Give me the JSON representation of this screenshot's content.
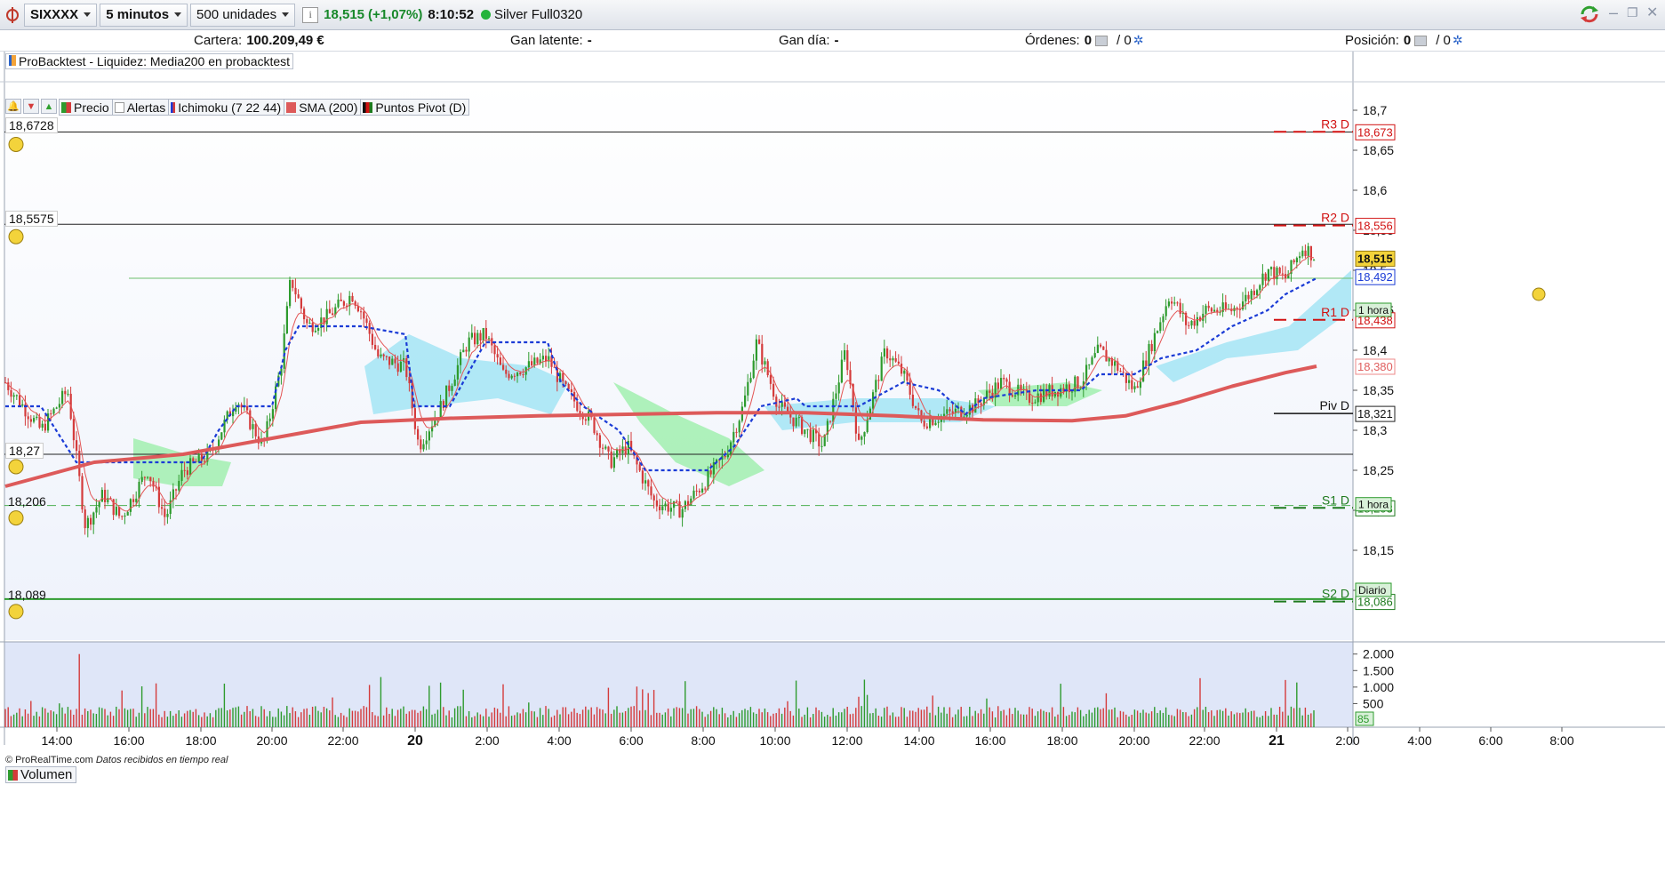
{
  "toolbar": {
    "instrument": "SIXXXX",
    "timeframe": "5 minutos",
    "units": "500 unidades",
    "info": "i",
    "last_price": "18,515",
    "change": "(+1,07%)",
    "time": "8:10:52",
    "contract": "Silver Full0320"
  },
  "account": {
    "cartera_label": "Cartera:",
    "cartera_value": "100.209,49 €",
    "gan_latente_label": "Gan latente:",
    "gan_latente_value": "-",
    "gan_dia_label": "Gan día:",
    "gan_dia_value": "-",
    "ordenes_label": "Órdenes:",
    "ordenes_value1": "0",
    "ordenes_value2": "/ 0",
    "posicion_label": "Posición:",
    "posicion_value1": "0",
    "posicion_value2": "/ 0"
  },
  "backtest_label": "ProBacktest - Liquidez: Media200 en probacktest",
  "legend": {
    "precio": "Precio",
    "alertas": "Alertas",
    "ichimoku": "Ichimoku (7 22 44)",
    "sma": "SMA (200)",
    "pivot": "Puntos Pivot (D)"
  },
  "hlines": {
    "h1": "18,6728",
    "h2": "18,5575",
    "h3": "18,27",
    "h4": "18,206",
    "h5": "18,089"
  },
  "pivot_labels": {
    "r3": "R3 D",
    "r3_value": "18,673",
    "r2": "R2 D",
    "r2_value": "18,556",
    "r1": "R1 D",
    "r1_value": "18,438",
    "piv": "Piv D",
    "piv_value": "18,321",
    "s1": "S1 D",
    "s1_value": "18,203",
    "s2": "S2 D",
    "s2_value": "18,086"
  },
  "price_tags": {
    "last": "18,515",
    "tenkan": "18,492",
    "sma": "18,380",
    "hora1": "1 hora",
    "hora2": "1 hora",
    "diario": "Diario"
  },
  "copyright": "© ProRealTime.com",
  "copyright_note": "Datos recibidos en tiempo real",
  "volume_label": "Volumen",
  "colors": {
    "up": "#2e9b2e",
    "down": "#d43b3b",
    "sma": "#dd5a5a",
    "kijun": "#1a3bd6",
    "r_line": "#d11111",
    "s_line": "#1e7a1e",
    "cloud_bull": "#a6f0b4",
    "cloud_bear": "#a8e6f5",
    "chart_bg": "#eef2fb"
  },
  "chart_data": {
    "type": "candlestick",
    "title": "SIXXXX",
    "y_axis": {
      "ticks": [
        "18,7",
        "18,65",
        "18,6",
        "18,55",
        "18,5",
        "18,45",
        "18,4",
        "18,35",
        "18,3",
        "18,25",
        "18,2",
        "18,15",
        "18,1"
      ],
      "range": [
        18.085,
        18.72
      ]
    },
    "x_axis": {
      "ticks": [
        "14:00",
        "16:00",
        "18:00",
        "20:00",
        "22:00",
        "20",
        "2:00",
        "4:00",
        "6:00",
        "8:00",
        "10:00",
        "12:00",
        "14:00",
        "16:00",
        "18:00",
        "20:00",
        "22:00",
        "21",
        "2:00",
        "4:00",
        "6:00",
        "8:00"
      ]
    },
    "price_path": [
      [
        0,
        18.36
      ],
      [
        20,
        18.33
      ],
      [
        40,
        18.3
      ],
      [
        70,
        18.35
      ],
      [
        90,
        18.18
      ],
      [
        110,
        18.22
      ],
      [
        130,
        18.19
      ],
      [
        160,
        18.25
      ],
      [
        180,
        18.19
      ],
      [
        200,
        18.25
      ],
      [
        230,
        18.27
      ],
      [
        260,
        18.34
      ],
      [
        290,
        18.28
      ],
      [
        310,
        18.38
      ],
      [
        321,
        18.49
      ],
      [
        340,
        18.43
      ],
      [
        360,
        18.44
      ],
      [
        390,
        18.47
      ],
      [
        400,
        18.45
      ],
      [
        420,
        18.39
      ],
      [
        450,
        18.38
      ],
      [
        465,
        18.28
      ],
      [
        490,
        18.33
      ],
      [
        520,
        18.41
      ],
      [
        540,
        18.42
      ],
      [
        560,
        18.37
      ],
      [
        590,
        18.38
      ],
      [
        610,
        18.39
      ],
      [
        630,
        18.35
      ],
      [
        660,
        18.31
      ],
      [
        680,
        18.26
      ],
      [
        700,
        18.28
      ],
      [
        730,
        18.21
      ],
      [
        760,
        18.2
      ],
      [
        790,
        18.24
      ],
      [
        810,
        18.27
      ],
      [
        830,
        18.33
      ],
      [
        845,
        18.41
      ],
      [
        870,
        18.33
      ],
      [
        900,
        18.3
      ],
      [
        920,
        18.28
      ],
      [
        945,
        18.4
      ],
      [
        960,
        18.28
      ],
      [
        990,
        18.4
      ],
      [
        1010,
        18.37
      ],
      [
        1030,
        18.31
      ],
      [
        1060,
        18.32
      ],
      [
        1090,
        18.33
      ],
      [
        1120,
        18.36
      ],
      [
        1150,
        18.34
      ],
      [
        1180,
        18.35
      ],
      [
        1210,
        18.36
      ],
      [
        1230,
        18.4
      ],
      [
        1250,
        18.38
      ],
      [
        1270,
        18.35
      ],
      [
        1290,
        18.41
      ],
      [
        1310,
        18.47
      ],
      [
        1330,
        18.43
      ],
      [
        1350,
        18.45
      ],
      [
        1380,
        18.45
      ],
      [
        1400,
        18.47
      ],
      [
        1420,
        18.5
      ],
      [
        1440,
        18.49
      ],
      [
        1460,
        18.53
      ],
      [
        1475,
        18.515
      ]
    ],
    "sma_200": [
      [
        0,
        18.23
      ],
      [
        100,
        18.26
      ],
      [
        200,
        18.27
      ],
      [
        300,
        18.29
      ],
      [
        400,
        18.31
      ],
      [
        500,
        18.315
      ],
      [
        600,
        18.318
      ],
      [
        700,
        18.32
      ],
      [
        800,
        18.322
      ],
      [
        900,
        18.322
      ],
      [
        1000,
        18.318
      ],
      [
        1100,
        18.313
      ],
      [
        1200,
        18.312
      ],
      [
        1260,
        18.318
      ],
      [
        1320,
        18.335
      ],
      [
        1380,
        18.355
      ],
      [
        1440,
        18.372
      ],
      [
        1475,
        18.38
      ]
    ],
    "kijun": [
      [
        0,
        18.33
      ],
      [
        40,
        18.33
      ],
      [
        80,
        18.26
      ],
      [
        130,
        18.26
      ],
      [
        180,
        18.26
      ],
      [
        220,
        18.26
      ],
      [
        240,
        18.3
      ],
      [
        260,
        18.33
      ],
      [
        300,
        18.33
      ],
      [
        315,
        18.4
      ],
      [
        330,
        18.43
      ],
      [
        400,
        18.43
      ],
      [
        450,
        18.42
      ],
      [
        460,
        18.33
      ],
      [
        500,
        18.33
      ],
      [
        540,
        18.41
      ],
      [
        560,
        18.41
      ],
      [
        610,
        18.41
      ],
      [
        625,
        18.36
      ],
      [
        650,
        18.33
      ],
      [
        690,
        18.3
      ],
      [
        720,
        18.25
      ],
      [
        760,
        18.25
      ],
      [
        790,
        18.25
      ],
      [
        820,
        18.28
      ],
      [
        850,
        18.33
      ],
      [
        890,
        18.34
      ],
      [
        900,
        18.33
      ],
      [
        960,
        18.33
      ],
      [
        1010,
        18.36
      ],
      [
        1050,
        18.35
      ],
      [
        1080,
        18.32
      ],
      [
        1100,
        18.34
      ],
      [
        1160,
        18.35
      ],
      [
        1210,
        18.35
      ],
      [
        1230,
        18.37
      ],
      [
        1270,
        18.37
      ],
      [
        1300,
        18.39
      ],
      [
        1340,
        18.4
      ],
      [
        1380,
        18.43
      ],
      [
        1420,
        18.45
      ],
      [
        1440,
        18.47
      ],
      [
        1475,
        18.49
      ]
    ],
    "pivots": {
      "R3": 18.673,
      "R2": 18.556,
      "R1": 18.438,
      "Piv": 18.321,
      "S1": 18.203,
      "S2": 18.086
    },
    "volume_axis_ticks": [
      "2.000",
      "1.500",
      "1.000",
      "500",
      "85"
    ]
  }
}
